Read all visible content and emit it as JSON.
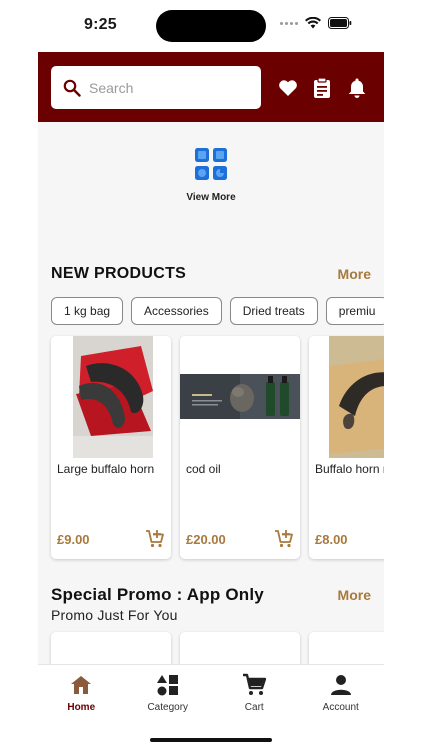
{
  "status_bar": {
    "time": "9:25"
  },
  "header": {
    "search_placeholder": "Search"
  },
  "quick_links": {
    "view_more_label": "View More"
  },
  "new_products": {
    "title": "NEW PRODUCTS",
    "more_label": "More",
    "chips": [
      "1 kg bag",
      "Accessories",
      "Dried treats",
      "premiu"
    ],
    "items": [
      {
        "name": "Large buffalo horn",
        "price": "£9.00"
      },
      {
        "name": "cod oil",
        "price": "£20.00"
      },
      {
        "name": "Buffalo horn medium",
        "price": "£8.00"
      }
    ]
  },
  "promo": {
    "title": "Special Promo : App Only",
    "more_label": "More",
    "subtitle": "Promo Just For You"
  },
  "bottom_nav": {
    "items": [
      {
        "label": "Home",
        "icon": "home-icon",
        "active": true
      },
      {
        "label": "Category",
        "icon": "category-icon",
        "active": false
      },
      {
        "label": "Cart",
        "icon": "cart-icon",
        "active": false
      },
      {
        "label": "Account",
        "icon": "account-icon",
        "active": false
      }
    ]
  },
  "colors": {
    "brand": "#6b0000",
    "accent": "#a9793d",
    "view_more_icon": "#1f6fd8"
  }
}
